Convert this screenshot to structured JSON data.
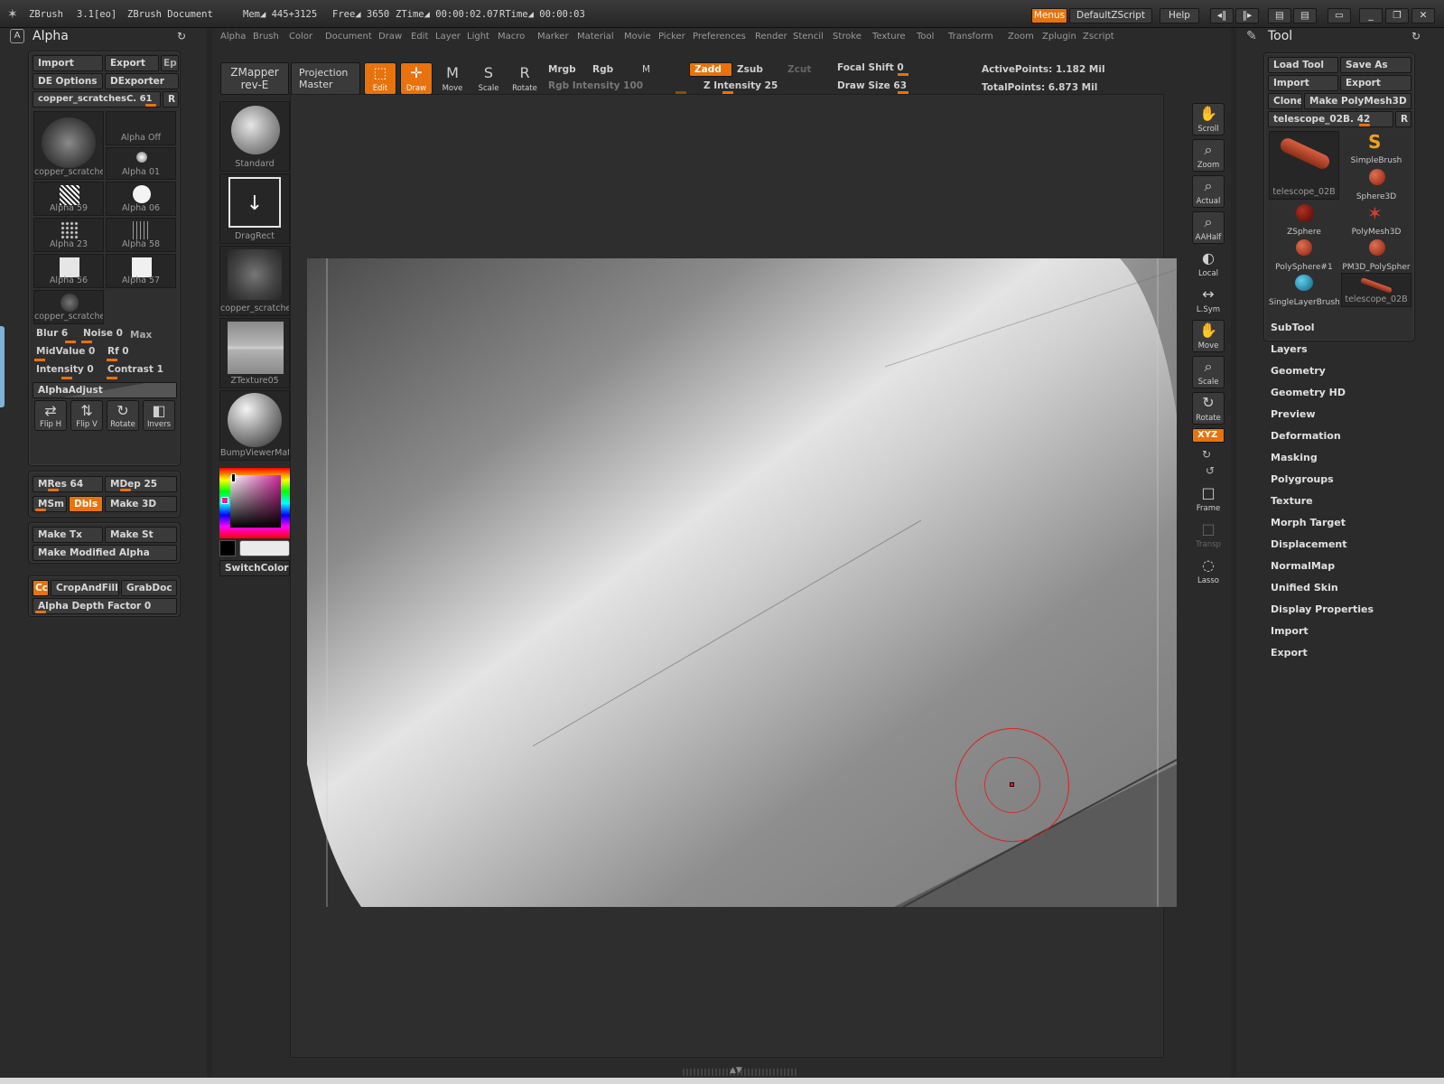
{
  "titlebar": {
    "app": "ZBrush",
    "version": "3.1[eo]",
    "document": "ZBrush Document",
    "mem": "Mem◢ 445+3125",
    "free": "Free◢ 3650",
    "ztime": "ZTime◢ 00:00:02.07",
    "rtime": "RTime◢ 00:00:03",
    "menus_btn": "Menus",
    "script_btn": "DefaultZScript",
    "help_btn": "Help"
  },
  "menubar": [
    "Alpha",
    "Brush",
    "Color",
    "Document",
    "Draw",
    "Edit",
    "Layer",
    "Light",
    "Macro",
    "Marker",
    "Material",
    "Movie",
    "Picker",
    "Preferences",
    "Render",
    "Stencil",
    "Stroke",
    "Texture",
    "Tool",
    "Transform",
    "Zoom",
    "Zplugin",
    "Zscript"
  ],
  "alpha_panel": {
    "title": "Alpha",
    "import": "Import",
    "export": "Export",
    "ep": "Ep",
    "de_options": "DE Options",
    "dexporter": "DExporter",
    "current": "copper_scratchesC. 61",
    "r_btn": "R",
    "thumbs": [
      {
        "label": "copper_scratche"
      },
      {
        "label": "Alpha Off"
      },
      {
        "label": "Alpha 01"
      },
      {
        "label": "Alpha 59"
      },
      {
        "label": "Alpha 06"
      },
      {
        "label": "Alpha 23"
      },
      {
        "label": "Alpha 58"
      },
      {
        "label": "Alpha 56"
      },
      {
        "label": "Alpha 57"
      },
      {
        "label": "copper_scratche"
      }
    ],
    "blur": "Blur 6",
    "noise": "Noise 0",
    "max": "Max",
    "midvalue": "MidValue 0",
    "rf": "Rf 0",
    "intensity": "Intensity 0",
    "contrast": "Contrast 1",
    "alphaadjust": "AlphaAdjust",
    "flip_h": "Flip H",
    "flip_v": "Flip V",
    "rotate": "Rotate",
    "invers": "Invers"
  },
  "alpha_panel2": {
    "mres": "MRes 64",
    "mdep": "MDep 25",
    "msm": "MSm",
    "dbls": "Dbls",
    "make3d": "Make 3D"
  },
  "alpha_panel3": {
    "make_tx": "Make Tx",
    "make_st": "Make St",
    "make_modified": "Make Modified Alpha"
  },
  "alpha_panel4": {
    "cc": "Cc",
    "cropandfill": "CropAndFill",
    "grabdoc": "GrabDoc",
    "depth_factor": "Alpha Depth Factor 0"
  },
  "shelf": {
    "zmapper": "ZMapper",
    "zmapper_rev": "rev-E",
    "projection": "Projection",
    "projection2": "Master",
    "edit": "Edit",
    "draw": "Draw",
    "move": "Move",
    "scale": "Scale",
    "rotate": "Rotate",
    "mrgb": "Mrgb",
    "rgb": "Rgb",
    "m": "M",
    "rgb_intensity": "Rgb Intensity 100",
    "zadd": "Zadd",
    "zsub": "Zsub",
    "zcut": "Zcut",
    "z_intensity": "Z Intensity 25",
    "focal_shift": "Focal Shift 0",
    "draw_size": "Draw Size 63",
    "active_points": "ActivePoints: 1.182 Mil",
    "total_points": "TotalPoints: 6.873 Mil"
  },
  "brush_column": [
    {
      "label": "Standard"
    },
    {
      "label": "DragRect"
    },
    {
      "label": "copper_scratche"
    },
    {
      "label": "ZTexture05"
    },
    {
      "label": "BumpViewerMate"
    }
  ],
  "switch_color": "SwitchColor",
  "right_tools": [
    {
      "label": "Scroll",
      "icon": "✋"
    },
    {
      "label": "Zoom",
      "icon": "⌕"
    },
    {
      "label": "Actual",
      "icon": "⌕"
    },
    {
      "label": "AAHalf",
      "icon": "⌕"
    },
    {
      "label": "Local",
      "icon": "◐"
    },
    {
      "label": "L.Sym",
      "icon": "↔"
    },
    {
      "label": "Move",
      "icon": "✋"
    },
    {
      "label": "Scale",
      "icon": "⌕"
    },
    {
      "label": "Rotate",
      "icon": "↻"
    },
    {
      "label": "Frame",
      "icon": "□"
    },
    {
      "label": "Transp",
      "icon": "□"
    },
    {
      "label": "Lasso",
      "icon": "◌"
    }
  ],
  "xyz": "XYZ",
  "tool_panel": {
    "title": "Tool",
    "load_tool": "Load Tool",
    "save_as": "Save As",
    "import": "Import",
    "export": "Export",
    "clone": "Clone",
    "make_polymesh": "Make PolyMesh3D",
    "current": "telescope_02B. 42",
    "r_btn": "R",
    "thumbs": [
      {
        "label": "telescope_02B",
        "color": "#b24a2a"
      },
      {
        "label": "SimpleBrush",
        "color": "#f0a020"
      },
      {
        "label": "Sphere3D",
        "color": "#b83a2a"
      },
      {
        "label": "ZSphere",
        "color": "#8a1a10"
      },
      {
        "label": "PolyMesh3D",
        "color": "#d04030"
      },
      {
        "label": "PolySphere#1",
        "color": "#b83a2a"
      },
      {
        "label": "PM3D_PolySpher",
        "color": "#b83a2a"
      },
      {
        "label": "SingleLayerBrush",
        "color": "#2aa0c0"
      },
      {
        "label": "telescope_02B",
        "color": "#b24a2a"
      }
    ],
    "subitems": [
      "SubTool",
      "Layers",
      "Geometry",
      "Geometry HD",
      "Preview",
      "Deformation",
      "Masking",
      "Polygroups",
      "Texture",
      "Morph Target",
      "Displacement",
      "NormalMap",
      "Unified Skin",
      "Display Properties",
      "Import",
      "Export"
    ]
  },
  "colors": {
    "accent": "#e8720c",
    "background": "#2a2a2a",
    "panel": "#2f2f2f"
  }
}
